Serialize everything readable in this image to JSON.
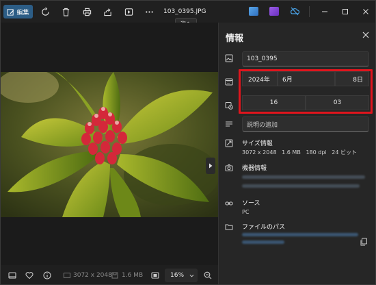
{
  "toolbar": {
    "edit_label": "編集",
    "filename": "103_0395.JPG",
    "tooltip": "次へ"
  },
  "panel": {
    "title": "情報",
    "filename_value": "103_0395",
    "date": {
      "year": "2024年",
      "month": "6月",
      "day": "8日"
    },
    "time": {
      "hour": "16",
      "minute": "03"
    },
    "description_placeholder": "説明の追加",
    "size": {
      "title": "サイズ情報",
      "details": "3072 x 2048   1.6 MB   180 dpi   24 ビット"
    },
    "device": {
      "title": "機器情報"
    },
    "source": {
      "title": "ソース",
      "value": "PC"
    },
    "path": {
      "title": "ファイルのパス"
    }
  },
  "bottom": {
    "dimensions": "3072 x 2048",
    "filesize": "1.6 MB",
    "zoom": "16%"
  },
  "colors": {
    "accent": "#2c5d86",
    "highlight": "#e0151d",
    "panel_bg": "#262626"
  },
  "icons": [
    "edit-icon",
    "rotate-icon",
    "delete-icon",
    "print-icon",
    "share-icon",
    "slideshow-icon",
    "more-icon",
    "close-icon",
    "image-icon",
    "calendar-icon",
    "clock-calendar-icon",
    "description-icon",
    "size-icon",
    "camera-icon",
    "link-icon",
    "folder-icon",
    "copy-icon",
    "filmstrip-icon",
    "favorite-icon",
    "info-icon",
    "fit-icon",
    "zoom-out-icon",
    "next-chevron-icon"
  ]
}
